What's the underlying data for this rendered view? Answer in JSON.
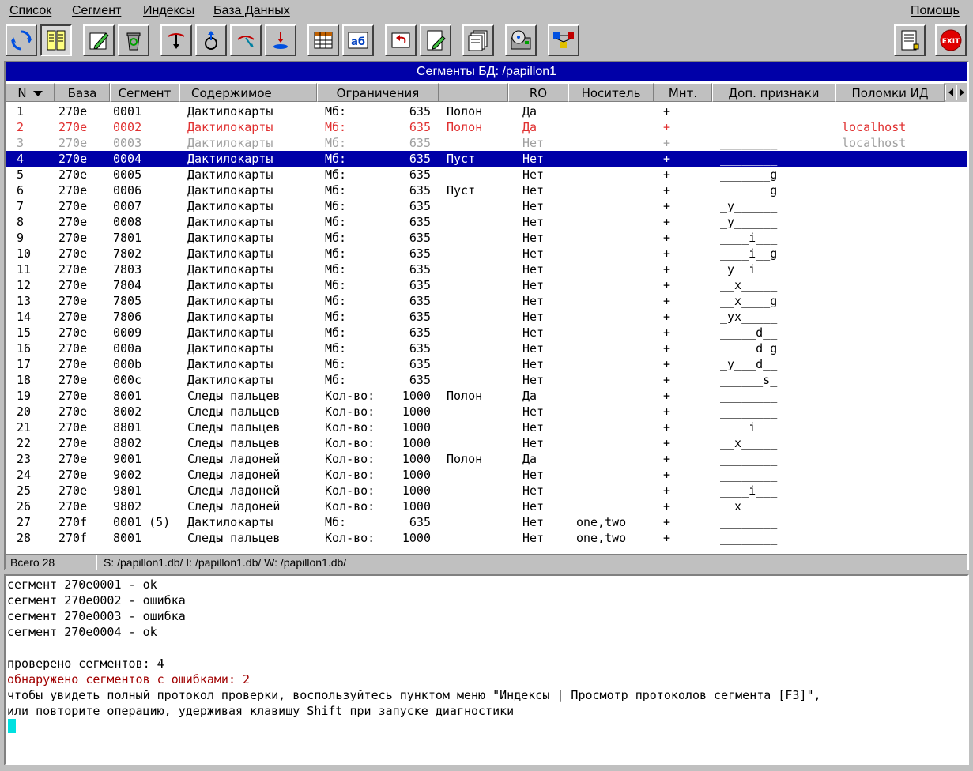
{
  "menu": {
    "items": [
      "Список",
      "Сегмент",
      "Индексы",
      "База Данных"
    ],
    "help": "Помощь"
  },
  "toolbar": {
    "buttons": [
      "refresh-icon",
      "columns-view-icon",
      "edit-pencil-icon",
      "recycle-bin-icon",
      "db-down-arrow-icon",
      "db-up-arrow-icon",
      "db-link-icon",
      "db-load-icon",
      "grid-table-icon",
      "ab-rename-icon",
      "undo-icon",
      "document-edit-icon",
      "pages-stack-icon",
      "disk-check-icon",
      "network-db-icon",
      "notes-icon",
      "exit-icon"
    ],
    "exit_label": "EXIT"
  },
  "panel": {
    "title": "Сегменты БД: /papillon1"
  },
  "columns": [
    "N",
    "База",
    "Сегмент",
    "Содержимое",
    "Ограничения",
    "",
    "RO",
    "Носитель",
    "Мнт.",
    "Доп. признаки",
    "Поломки ИД"
  ],
  "rows": [
    {
      "n": "1",
      "base": "270e",
      "seg": "0001",
      "content": "Дактилокарты",
      "lim": "Мб:",
      "val": "635",
      "status": "Полон",
      "ro": "Да",
      "media": "",
      "mnt": "+",
      "extra": "________",
      "broken": "",
      "state": "normal"
    },
    {
      "n": "2",
      "base": "270e",
      "seg": "0002",
      "content": "Дактилокарты",
      "lim": "Мб:",
      "val": "635",
      "status": "Полон",
      "ro": "Да",
      "media": "",
      "mnt": "+",
      "extra": "________",
      "broken": "localhost",
      "state": "err"
    },
    {
      "n": "3",
      "base": "270e",
      "seg": "0003",
      "content": "Дактилокарты",
      "lim": "Мб:",
      "val": "635",
      "status": "",
      "ro": "Нет",
      "media": "",
      "mnt": "+",
      "extra": "________",
      "broken": "localhost",
      "state": "dim"
    },
    {
      "n": "4",
      "base": "270e",
      "seg": "0004",
      "content": "Дактилокарты",
      "lim": "Мб:",
      "val": "635",
      "status": "Пуст",
      "ro": "Нет",
      "media": "",
      "mnt": "+",
      "extra": "________",
      "broken": "",
      "state": "selected"
    },
    {
      "n": "5",
      "base": "270e",
      "seg": "0005",
      "content": "Дактилокарты",
      "lim": "Мб:",
      "val": "635",
      "status": "",
      "ro": "Нет",
      "media": "",
      "mnt": "+",
      "extra": "_______g",
      "broken": "",
      "state": "normal"
    },
    {
      "n": "6",
      "base": "270e",
      "seg": "0006",
      "content": "Дактилокарты",
      "lim": "Мб:",
      "val": "635",
      "status": "Пуст",
      "ro": "Нет",
      "media": "",
      "mnt": "+",
      "extra": "_______g",
      "broken": "",
      "state": "normal"
    },
    {
      "n": "7",
      "base": "270e",
      "seg": "0007",
      "content": "Дактилокарты",
      "lim": "Мб:",
      "val": "635",
      "status": "",
      "ro": "Нет",
      "media": "",
      "mnt": "+",
      "extra": "_y______",
      "broken": "",
      "state": "normal"
    },
    {
      "n": "8",
      "base": "270e",
      "seg": "0008",
      "content": "Дактилокарты",
      "lim": "Мб:",
      "val": "635",
      "status": "",
      "ro": "Нет",
      "media": "",
      "mnt": "+",
      "extra": "_y______",
      "broken": "",
      "state": "normal"
    },
    {
      "n": "9",
      "base": "270e",
      "seg": "7801",
      "content": "Дактилокарты",
      "lim": "Мб:",
      "val": "635",
      "status": "",
      "ro": "Нет",
      "media": "",
      "mnt": "+",
      "extra": "____i___",
      "broken": "",
      "state": "normal"
    },
    {
      "n": "10",
      "base": "270e",
      "seg": "7802",
      "content": "Дактилокарты",
      "lim": "Мб:",
      "val": "635",
      "status": "",
      "ro": "Нет",
      "media": "",
      "mnt": "+",
      "extra": "____i__g",
      "broken": "",
      "state": "normal"
    },
    {
      "n": "11",
      "base": "270e",
      "seg": "7803",
      "content": "Дактилокарты",
      "lim": "Мб:",
      "val": "635",
      "status": "",
      "ro": "Нет",
      "media": "",
      "mnt": "+",
      "extra": "_y__i___",
      "broken": "",
      "state": "normal"
    },
    {
      "n": "12",
      "base": "270e",
      "seg": "7804",
      "content": "Дактилокарты",
      "lim": "Мб:",
      "val": "635",
      "status": "",
      "ro": "Нет",
      "media": "",
      "mnt": "+",
      "extra": "__x_____",
      "broken": "",
      "state": "normal"
    },
    {
      "n": "13",
      "base": "270e",
      "seg": "7805",
      "content": "Дактилокарты",
      "lim": "Мб:",
      "val": "635",
      "status": "",
      "ro": "Нет",
      "media": "",
      "mnt": "+",
      "extra": "__x____g",
      "broken": "",
      "state": "normal"
    },
    {
      "n": "14",
      "base": "270e",
      "seg": "7806",
      "content": "Дактилокарты",
      "lim": "Мб:",
      "val": "635",
      "status": "",
      "ro": "Нет",
      "media": "",
      "mnt": "+",
      "extra": "_yx_____",
      "broken": "",
      "state": "normal"
    },
    {
      "n": "15",
      "base": "270e",
      "seg": "0009",
      "content": "Дактилокарты",
      "lim": "Мб:",
      "val": "635",
      "status": "",
      "ro": "Нет",
      "media": "",
      "mnt": "+",
      "extra": "_____d__",
      "broken": "",
      "state": "normal"
    },
    {
      "n": "16",
      "base": "270e",
      "seg": "000a",
      "content": "Дактилокарты",
      "lim": "Мб:",
      "val": "635",
      "status": "",
      "ro": "Нет",
      "media": "",
      "mnt": "+",
      "extra": "_____d_g",
      "broken": "",
      "state": "normal"
    },
    {
      "n": "17",
      "base": "270e",
      "seg": "000b",
      "content": "Дактилокарты",
      "lim": "Мб:",
      "val": "635",
      "status": "",
      "ro": "Нет",
      "media": "",
      "mnt": "+",
      "extra": "_y___d__",
      "broken": "",
      "state": "normal"
    },
    {
      "n": "18",
      "base": "270e",
      "seg": "000c",
      "content": "Дактилокарты",
      "lim": "Мб:",
      "val": "635",
      "status": "",
      "ro": "Нет",
      "media": "",
      "mnt": "+",
      "extra": "______s_",
      "broken": "",
      "state": "normal"
    },
    {
      "n": "19",
      "base": "270e",
      "seg": "8001",
      "content": "Следы пальцев",
      "lim": "Кол-во:",
      "val": "1000",
      "status": "Полон",
      "ro": "Да",
      "media": "",
      "mnt": "+",
      "extra": "________",
      "broken": "",
      "state": "normal"
    },
    {
      "n": "20",
      "base": "270e",
      "seg": "8002",
      "content": "Следы пальцев",
      "lim": "Кол-во:",
      "val": "1000",
      "status": "",
      "ro": "Нет",
      "media": "",
      "mnt": "+",
      "extra": "________",
      "broken": "",
      "state": "normal"
    },
    {
      "n": "21",
      "base": "270e",
      "seg": "8801",
      "content": "Следы пальцев",
      "lim": "Кол-во:",
      "val": "1000",
      "status": "",
      "ro": "Нет",
      "media": "",
      "mnt": "+",
      "extra": "____i___",
      "broken": "",
      "state": "normal"
    },
    {
      "n": "22",
      "base": "270e",
      "seg": "8802",
      "content": "Следы пальцев",
      "lim": "Кол-во:",
      "val": "1000",
      "status": "",
      "ro": "Нет",
      "media": "",
      "mnt": "+",
      "extra": "__x_____",
      "broken": "",
      "state": "normal"
    },
    {
      "n": "23",
      "base": "270e",
      "seg": "9001",
      "content": "Следы ладоней",
      "lim": "Кол-во:",
      "val": "1000",
      "status": "Полон",
      "ro": "Да",
      "media": "",
      "mnt": "+",
      "extra": "________",
      "broken": "",
      "state": "normal"
    },
    {
      "n": "24",
      "base": "270e",
      "seg": "9002",
      "content": "Следы ладоней",
      "lim": "Кол-во:",
      "val": "1000",
      "status": "",
      "ro": "Нет",
      "media": "",
      "mnt": "+",
      "extra": "________",
      "broken": "",
      "state": "normal"
    },
    {
      "n": "25",
      "base": "270e",
      "seg": "9801",
      "content": "Следы ладоней",
      "lim": "Кол-во:",
      "val": "1000",
      "status": "",
      "ro": "Нет",
      "media": "",
      "mnt": "+",
      "extra": "____i___",
      "broken": "",
      "state": "normal"
    },
    {
      "n": "26",
      "base": "270e",
      "seg": "9802",
      "content": "Следы ладоней",
      "lim": "Кол-во:",
      "val": "1000",
      "status": "",
      "ro": "Нет",
      "media": "",
      "mnt": "+",
      "extra": "__x_____",
      "broken": "",
      "state": "normal"
    },
    {
      "n": "27",
      "base": "270f",
      "seg": "0001 (5)",
      "content": "Дактилокарты",
      "lim": "Мб:",
      "val": "635",
      "status": "",
      "ro": "Нет",
      "media": "one,two",
      "mnt": "+",
      "extra": "________",
      "broken": "",
      "state": "normal"
    },
    {
      "n": "28",
      "base": "270f",
      "seg": "8001",
      "content": "Следы пальцев",
      "lim": "Кол-во:",
      "val": "1000",
      "status": "",
      "ro": "Нет",
      "media": "one,two",
      "mnt": "+",
      "extra": "________",
      "broken": "",
      "state": "normal"
    }
  ],
  "statusbar": {
    "total": "Всего 28",
    "paths": "S: /papillon1.db/  I: /papillon1.db/  W: /papillon1.db/"
  },
  "log": {
    "lines": [
      {
        "text": "сегмент 270e0001 - ok",
        "type": "normal"
      },
      {
        "text": "сегмент 270e0002 - ошибка",
        "type": "normal"
      },
      {
        "text": "сегмент 270e0003 - ошибка",
        "type": "normal"
      },
      {
        "text": "сегмент 270e0004 - ok",
        "type": "normal"
      },
      {
        "text": "",
        "type": "normal"
      },
      {
        "text": "проверено сегментов: 4",
        "type": "normal"
      },
      {
        "text": "обнаружено сегментов с ошибками: 2",
        "type": "error"
      },
      {
        "text": "чтобы увидеть полный протокол проверки, воспользуйтесь пунктом меню \"Индексы | Просмотр протоколов сегмента [F3]\",",
        "type": "normal"
      },
      {
        "text": "или повторите операцию, удерживая клавишу Shift при запуске диагностики",
        "type": "normal"
      }
    ]
  },
  "colors": {
    "title_bg": "#0000a8",
    "selected_bg": "#0000a8",
    "error_row": "#e03030",
    "dim_row": "#a0a0a0",
    "error_log": "#a00000",
    "cursor": "#00e0e0"
  }
}
